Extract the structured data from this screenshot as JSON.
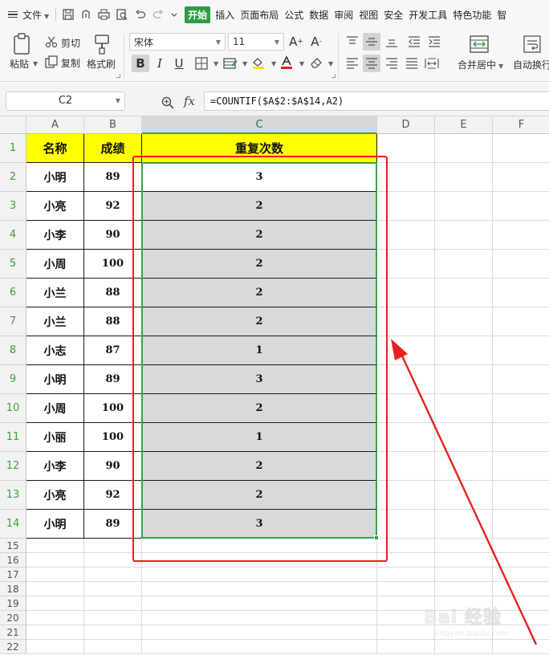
{
  "menubar": {
    "file_label": "文件",
    "tabs": [
      {
        "label": "开始",
        "active": true
      },
      {
        "label": "插入"
      },
      {
        "label": "页面布局"
      },
      {
        "label": "公式"
      },
      {
        "label": "数据"
      },
      {
        "label": "审阅"
      },
      {
        "label": "视图"
      },
      {
        "label": "安全"
      },
      {
        "label": "开发工具"
      },
      {
        "label": "特色功能"
      },
      {
        "label": "智"
      }
    ]
  },
  "ribbon": {
    "paste_label": "粘贴",
    "cut_label": "剪切",
    "copy_label": "复制",
    "format_painter_label": "格式刷",
    "font_name": "宋体",
    "font_size": "11",
    "bold_label": "B",
    "italic_label": "I",
    "underline_label": "U",
    "font_grow_label": "A",
    "font_shrink_label": "A",
    "merge_center_label": "合并居中",
    "auto_wrap_label": "自动换行",
    "font_color": "#e02020",
    "fill_color": "#ffe600",
    "accent": "#2f9c45"
  },
  "formula_bar": {
    "cell_ref": "C2",
    "fx_label": "fx",
    "formula": "=COUNTIF($A$2:$A$14,A2)"
  },
  "sheet": {
    "columns": [
      "A",
      "B",
      "C",
      "D",
      "E",
      "F"
    ],
    "active_column": "C",
    "row_numbers": [
      "1",
      "2",
      "3",
      "4",
      "5",
      "6",
      "7",
      "8",
      "9",
      "10",
      "11",
      "12",
      "13",
      "14",
      "15",
      "16",
      "17",
      "18",
      "19",
      "20",
      "21",
      "22"
    ],
    "header": [
      "名称",
      "成绩",
      "重复次数"
    ],
    "header_fill": "#ffff00",
    "rows": [
      [
        "小明",
        "89",
        "3"
      ],
      [
        "小亮",
        "92",
        "2"
      ],
      [
        "小李",
        "90",
        "2"
      ],
      [
        "小周",
        "100",
        "2"
      ],
      [
        "小兰",
        "88",
        "2"
      ],
      [
        "小兰",
        "88",
        "2"
      ],
      [
        "小志",
        "87",
        "1"
      ],
      [
        "小明",
        "89",
        "3"
      ],
      [
        "小周",
        "100",
        "2"
      ],
      [
        "小丽",
        "100",
        "1"
      ],
      [
        "小李",
        "90",
        "2"
      ],
      [
        "小亮",
        "92",
        "2"
      ],
      [
        "小明",
        "89",
        "3"
      ]
    ],
    "selection_color": "#3ca04a",
    "annotation_color": "#e82020"
  },
  "watermark": {
    "main": "Bai 经验",
    "sub": "jingyan.baidu.com"
  }
}
